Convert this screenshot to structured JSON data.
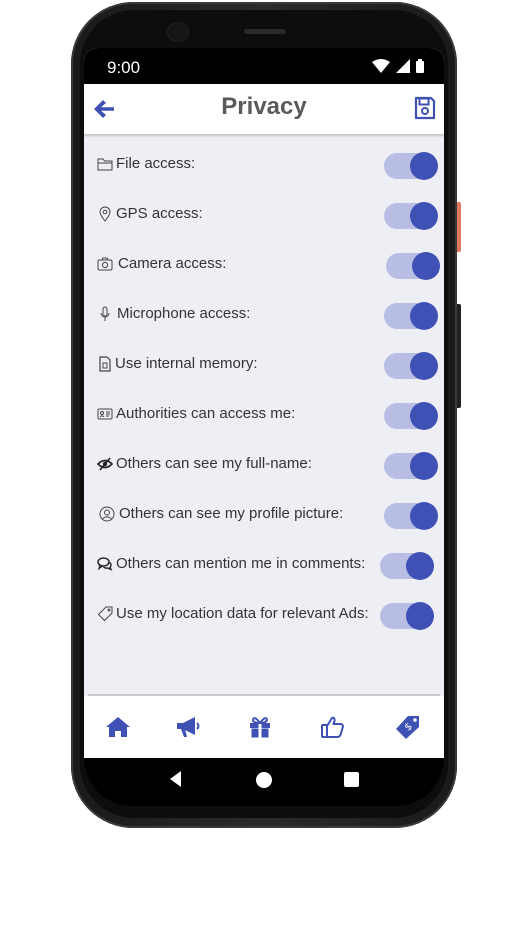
{
  "status": {
    "time": "9:00"
  },
  "appbar": {
    "title": "Privacy"
  },
  "settings": [
    {
      "label": "File access:",
      "icon": "folder-icon",
      "enabled": true
    },
    {
      "label": "GPS access:",
      "icon": "location-pin-icon",
      "enabled": true
    },
    {
      "label": "Camera access:",
      "icon": "camera-icon",
      "enabled": true
    },
    {
      "label": "Microphone access:",
      "icon": "microphone-icon",
      "enabled": true
    },
    {
      "label": "Use internal memory:",
      "icon": "memory-file-icon",
      "enabled": true
    },
    {
      "label": "Authorities can access me:",
      "icon": "id-card-icon",
      "enabled": true
    },
    {
      "label": "Others can see my full-name:",
      "icon": "eye-slash-icon",
      "enabled": true
    },
    {
      "label": "Others can see my profile picture:",
      "icon": "user-circle-icon",
      "enabled": true
    },
    {
      "label": "Others can mention me in comments:",
      "icon": "comments-icon",
      "enabled": true
    },
    {
      "label": "Use my location data for relevant Ads:",
      "icon": "tag-icon",
      "enabled": true
    }
  ],
  "bottom_nav": [
    "home-icon",
    "megaphone-icon",
    "gift-icon",
    "thumbs-up-icon",
    "price-tag-icon"
  ],
  "colors": {
    "accent": "#3f51b5",
    "toggle_track": "#b7bde3",
    "background": "#eeeff4",
    "title": "#5a5a5a"
  }
}
